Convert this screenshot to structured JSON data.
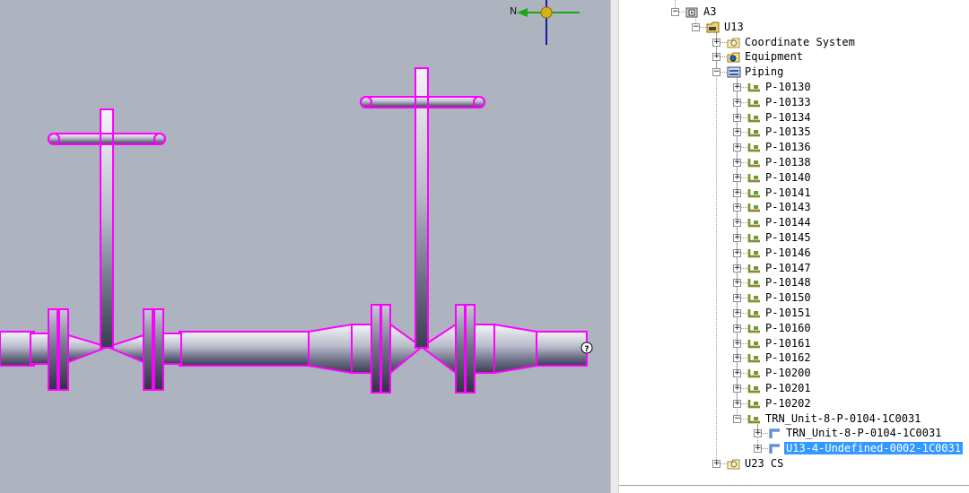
{
  "tree": {
    "items": [
      {
        "label": "A3",
        "icon": "area-icon",
        "depth": 0,
        "expander": "minus"
      },
      {
        "label": "U13",
        "icon": "unit-folder-icon",
        "depth": 1,
        "expander": "minus"
      },
      {
        "label": "Coordinate System",
        "icon": "coordinate-system-icon",
        "depth": 2,
        "expander": "plus"
      },
      {
        "label": "Equipment",
        "icon": "equipment-icon",
        "depth": 2,
        "expander": "plus"
      },
      {
        "label": "Piping",
        "icon": "piping-icon",
        "depth": 2,
        "expander": "minus"
      },
      {
        "label": "P-10130",
        "icon": "pipeline-icon",
        "depth": 3,
        "expander": "plus"
      },
      {
        "label": "P-10133",
        "icon": "pipeline-icon",
        "depth": 3,
        "expander": "plus"
      },
      {
        "label": "P-10134",
        "icon": "pipeline-icon",
        "depth": 3,
        "expander": "plus"
      },
      {
        "label": "P-10135",
        "icon": "pipeline-icon",
        "depth": 3,
        "expander": "plus"
      },
      {
        "label": "P-10136",
        "icon": "pipeline-icon",
        "depth": 3,
        "expander": "plus"
      },
      {
        "label": "P-10138",
        "icon": "pipeline-icon",
        "depth": 3,
        "expander": "plus"
      },
      {
        "label": "P-10140",
        "icon": "pipeline-icon",
        "depth": 3,
        "expander": "plus"
      },
      {
        "label": "P-10141",
        "icon": "pipeline-icon",
        "depth": 3,
        "expander": "plus"
      },
      {
        "label": "P-10143",
        "icon": "pipeline-icon",
        "depth": 3,
        "expander": "plus"
      },
      {
        "label": "P-10144",
        "icon": "pipeline-icon",
        "depth": 3,
        "expander": "plus"
      },
      {
        "label": "P-10145",
        "icon": "pipeline-icon",
        "depth": 3,
        "expander": "plus"
      },
      {
        "label": "P-10146",
        "icon": "pipeline-icon",
        "depth": 3,
        "expander": "plus"
      },
      {
        "label": "P-10147",
        "icon": "pipeline-icon",
        "depth": 3,
        "expander": "plus"
      },
      {
        "label": "P-10148",
        "icon": "pipeline-icon",
        "depth": 3,
        "expander": "plus"
      },
      {
        "label": "P-10150",
        "icon": "pipeline-icon",
        "depth": 3,
        "expander": "plus"
      },
      {
        "label": "P-10151",
        "icon": "pipeline-icon",
        "depth": 3,
        "expander": "plus"
      },
      {
        "label": "P-10160",
        "icon": "pipeline-icon",
        "depth": 3,
        "expander": "plus"
      },
      {
        "label": "P-10161",
        "icon": "pipeline-icon",
        "depth": 3,
        "expander": "plus"
      },
      {
        "label": "P-10162",
        "icon": "pipeline-icon",
        "depth": 3,
        "expander": "plus"
      },
      {
        "label": "P-10200",
        "icon": "pipeline-icon",
        "depth": 3,
        "expander": "plus"
      },
      {
        "label": "P-10201",
        "icon": "pipeline-icon",
        "depth": 3,
        "expander": "plus"
      },
      {
        "label": "P-10202",
        "icon": "pipeline-icon",
        "depth": 3,
        "expander": "plus"
      },
      {
        "label": "TRN_Unit-8-P-0104-1C0031",
        "icon": "pipeline-icon",
        "depth": 3,
        "expander": "minus"
      },
      {
        "label": "TRN_Unit-8-P-0104-1C0031",
        "icon": "pipe-run-icon",
        "depth": 4,
        "expander": "plus"
      },
      {
        "label": "U13-4-Undefined-0002-1C0031",
        "icon": "pipe-run-icon",
        "depth": 4,
        "expander": "plus",
        "selected": true
      },
      {
        "label": "U23 CS",
        "icon": "coordinate-system-icon",
        "depth": 2,
        "expander": "plus"
      }
    ]
  },
  "viewport": {
    "compass_north": "N",
    "help_marker": "?",
    "colors": {
      "background": "#aeb3c0",
      "highlight": "#ff00ff",
      "selection": "#3399ff",
      "compass_x": "#1aa81a",
      "compass_y": "#1a1aa8"
    }
  }
}
